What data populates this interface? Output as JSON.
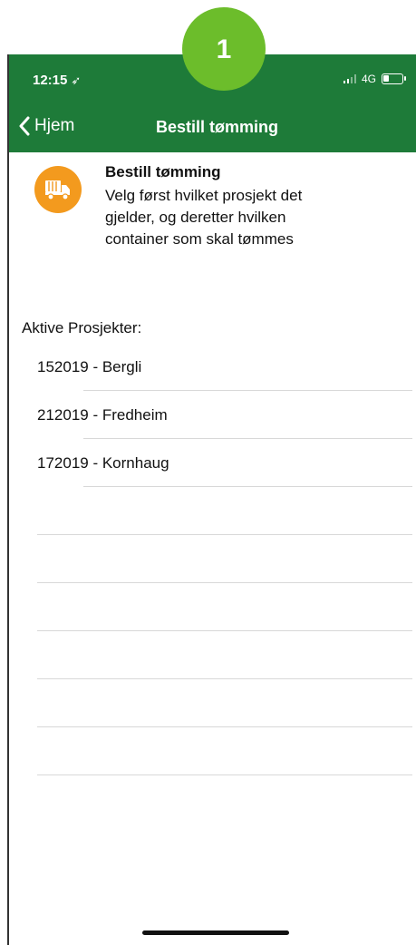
{
  "step_badge": "1",
  "status": {
    "time": "12:15",
    "location_glyph": "➶",
    "network": "4G",
    "battery_level": 0.35
  },
  "nav": {
    "back_label": "Hjem",
    "title": "Bestill tømming",
    "bar_color": "#1e7b39"
  },
  "info": {
    "icon": "truck-icon",
    "icon_color": "#f39a1e",
    "title": "Bestill tømming",
    "lines": [
      "Velg først hvilket prosjekt det",
      "gjelder, og deretter hvilken",
      "container som skal tømmes"
    ]
  },
  "projects": {
    "label": "Aktive Prosjekter:",
    "items": [
      "152019 - Bergli",
      "212019 - Fredheim",
      "172019 - Kornhaug",
      "",
      "",
      "",
      "",
      "",
      "",
      ""
    ]
  }
}
